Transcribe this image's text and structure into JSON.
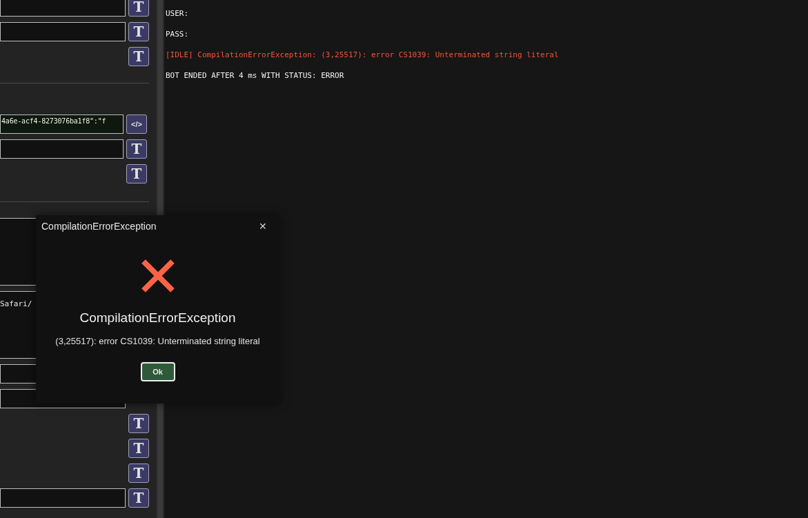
{
  "settings_panel": {
    "groups": [
      [
        {
          "kind": "field",
          "button": "T"
        },
        {
          "kind": "field",
          "button": "T"
        },
        {
          "kind": "button_only",
          "button": "T"
        }
      ],
      [
        {
          "kind": "code_field",
          "value": "4a6e-acf4-8273076ba1f8\":\"f",
          "button": "</>"
        },
        {
          "kind": "field",
          "button": "T"
        },
        {
          "kind": "button_only",
          "button": "T"
        }
      ],
      [
        {
          "kind": "textarea"
        },
        {
          "kind": "textarea",
          "value": "Safari/"
        },
        {
          "kind": "field"
        },
        {
          "kind": "field"
        },
        {
          "kind": "button_only",
          "button": "T"
        },
        {
          "kind": "button_only",
          "button": "T"
        },
        {
          "kind": "button_only",
          "button": "T"
        },
        {
          "kind": "field",
          "button": "T"
        }
      ]
    ]
  },
  "log": [
    {
      "kind": "info",
      "text": "USER:"
    },
    {
      "kind": "info",
      "text": "PASS:"
    },
    {
      "kind": "error",
      "text": "[IDLE] CompilationErrorException: (3,25517): error CS1039: Unterminated string literal"
    },
    {
      "kind": "info",
      "text": "BOT ENDED AFTER 4 ms WITH STATUS: ERROR"
    }
  ],
  "dialog": {
    "title": "CompilationErrorException",
    "close": "✕",
    "heading": "CompilationErrorException",
    "message": "(3,25517): error CS1039: Unterminated string literal",
    "button": "Ok"
  }
}
